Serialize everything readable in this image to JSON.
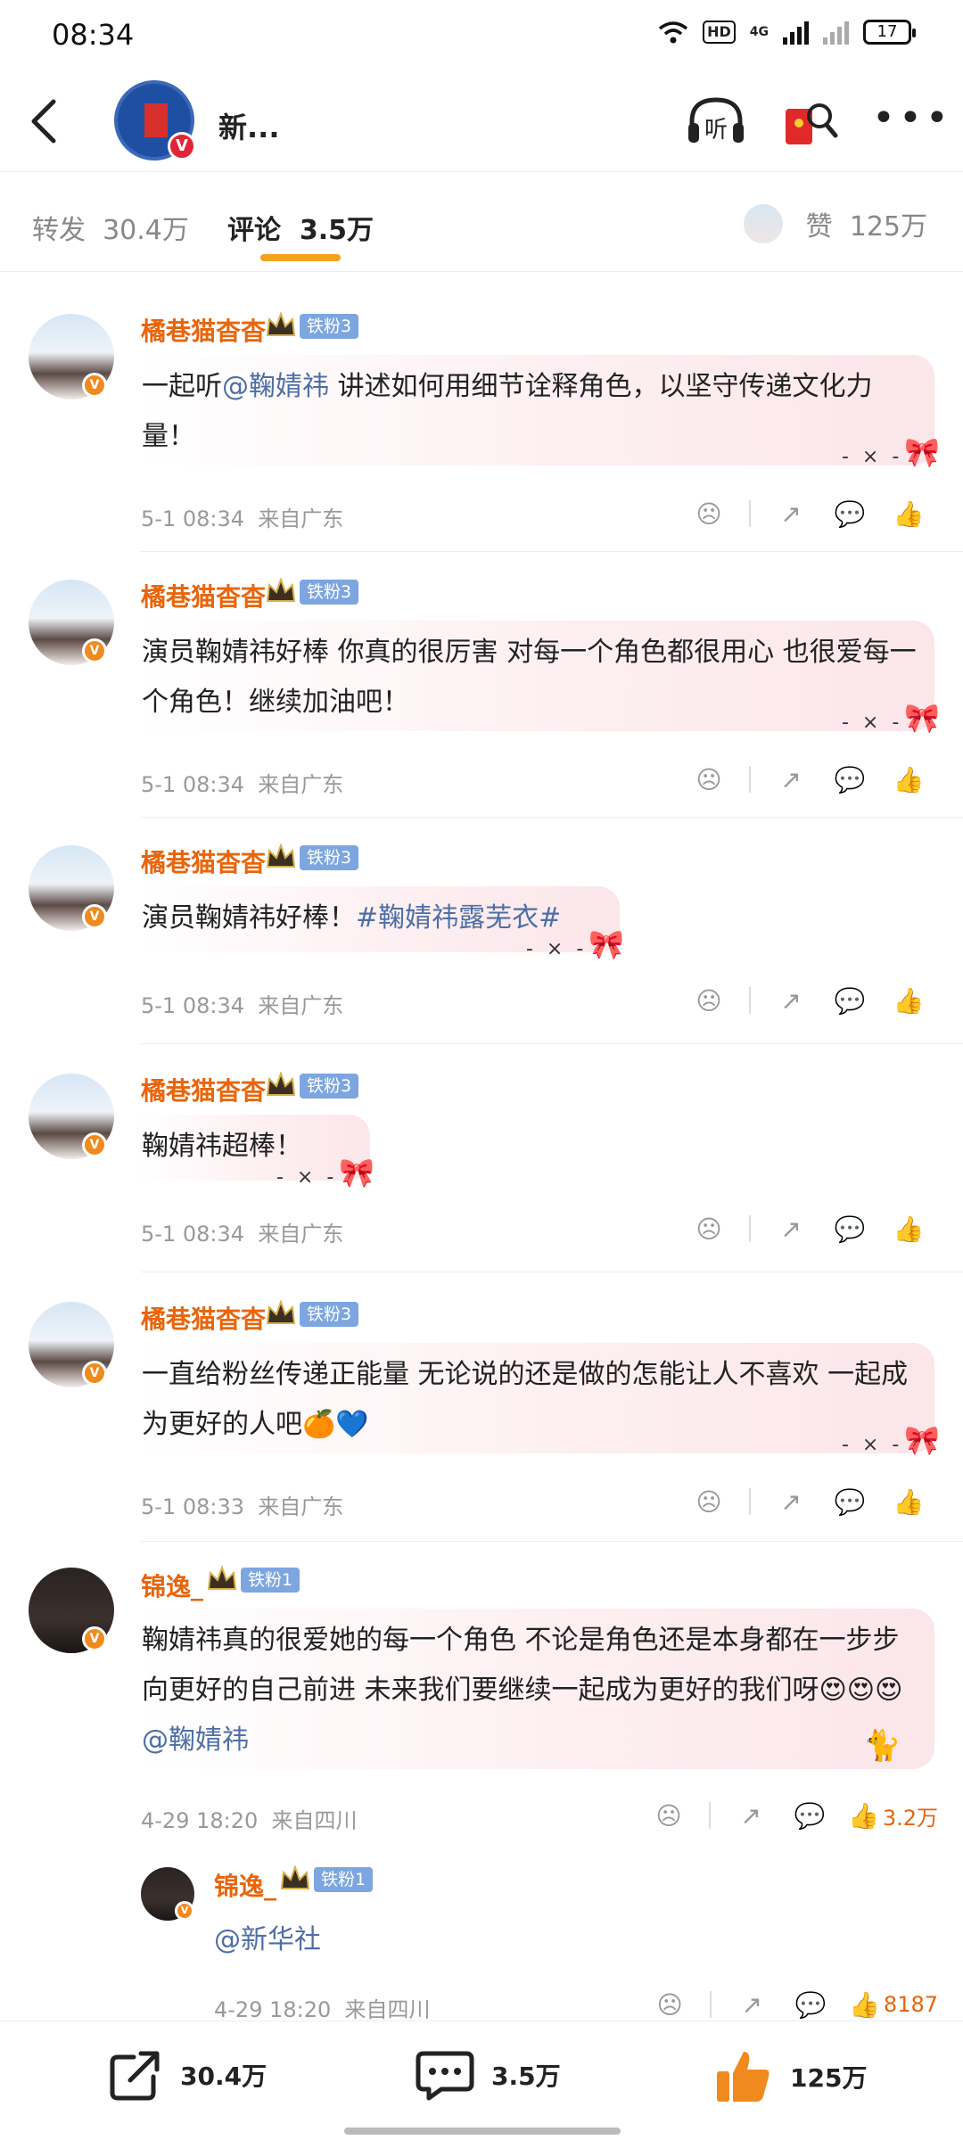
{
  "status_bar": {
    "time": "08:34",
    "battery": "17",
    "network": "4G",
    "hd": "HD"
  },
  "header": {
    "account_name": "新...",
    "logo_badge": "V",
    "listen_label": "听"
  },
  "tabs": [
    {
      "label": "转发",
      "count": "30.4万"
    },
    {
      "label": "评论",
      "count": "3.5万"
    },
    {
      "label": "赞",
      "count": "125万"
    }
  ],
  "comments": [
    {
      "user": "橘巷猫杳杳",
      "fan_level": "铁粉3",
      "text_before": "一起听",
      "mention": "@鞠婧祎",
      "text_after": " 讲述如何用细节诠释角色，以坚守传递文化力量！",
      "date": "5-1",
      "time": "08:34",
      "location": "来自广东"
    },
    {
      "user": "橘巷猫杳杳",
      "fan_level": "铁粉3",
      "text_before": "演员鞠婧祎好棒  你真的很厉害  对每一个角色都很用心  也很爱每一个角色！继续加油吧！",
      "mention": "",
      "text_after": "",
      "date": "5-1",
      "time": "08:34",
      "location": "来自广东"
    },
    {
      "user": "橘巷猫杳杳",
      "fan_level": "铁粉3",
      "text_before": "演员鞠婧祎好棒！",
      "hashtag": "#鞠婧祎露芜衣#",
      "text_after": "",
      "date": "5-1",
      "time": "08:34",
      "location": "来自广东"
    },
    {
      "user": "橘巷猫杳杳",
      "fan_level": "铁粉3",
      "text_before": "鞠婧祎超棒！",
      "mention": "",
      "text_after": "",
      "date": "5-1",
      "time": "08:34",
      "location": "来自广东"
    },
    {
      "user": "橘巷猫杳杳",
      "fan_level": "铁粉3",
      "text_before": "一直给粉丝传递正能量  无论说的还是做的怎能让人不喜欢   一起成为更好的人吧🍊💙",
      "mention": "",
      "text_after": "",
      "date": "5-1",
      "time": "08:33",
      "location": "来自广东"
    },
    {
      "user": "锦逸_",
      "fan_level": "铁粉1",
      "text_before": "鞠婧祎真的很爱她的每一个角色  不论是角色还是本身都在一步步向更好的自己前进  未来我们要继续一起成为更好的我们呀😍😍😍",
      "mention": "@鞠婧祎",
      "text_after": "",
      "date": "4-29",
      "time": "18:20",
      "location": "来自四川",
      "likes": "3.2万"
    }
  ],
  "reply": {
    "user": "锦逸_",
    "fan_level": "铁粉1",
    "mention": "@新华社",
    "date": "4-29",
    "time": "18:20",
    "location": "来自四川",
    "likes": "8187"
  },
  "bottom_bar": {
    "repost_count": "30.4万",
    "comment_count": "3.5万",
    "like_count": "125万"
  },
  "colors": {
    "username": "#e8650d",
    "link": "#4e6ea7",
    "tab_underline": "#f3a21e",
    "fan_badge": "#7da6e0",
    "like_active": "#f08a1e"
  }
}
